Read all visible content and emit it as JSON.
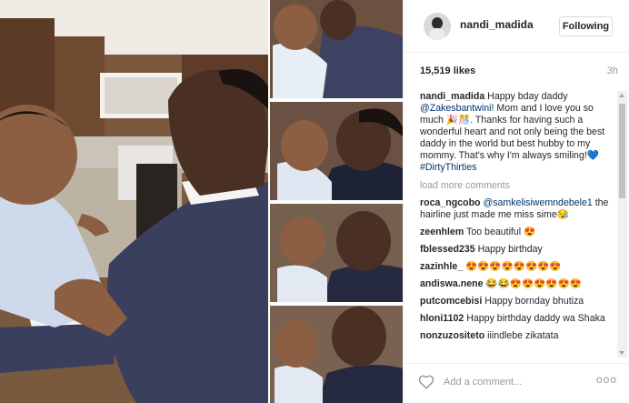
{
  "post": {
    "username": "nandi_madida",
    "follow_label": "Following",
    "likes": "15,519 likes",
    "time": "3h"
  },
  "caption": {
    "username": "nandi_madida",
    "text_1": " Happy bday daddy ",
    "mention": "@Zakesbantwini",
    "text_2": "! Mom and I love you so much 🎉🎊. Thanks for having such a wonderful heart and not only being the best daddy in the world but best hubby to my mommy. That's why I'm always smiling!💙 ",
    "hashtag": "#DirtyThirties"
  },
  "load_more": "load more comments",
  "comments": [
    {
      "user": "roca_ngcobo",
      "mention": "@samkelisiwemndebele1",
      "text": " the hairline just made me miss sime😪"
    },
    {
      "user": "zeenhlem",
      "mention": "",
      "text": " Too beautiful 😍"
    },
    {
      "user": "fblessed235",
      "mention": "",
      "text": " Happy birthday"
    },
    {
      "user": "zazinhle_",
      "mention": "",
      "text": " 😍😍😍😍😍😍😍😍"
    },
    {
      "user": "andiswa.nene",
      "mention": "",
      "text": " 😂😂😍😍😍😍😍😍"
    },
    {
      "user": "putcomcebisi",
      "mention": "",
      "text": " Happy bornday bhutiza"
    },
    {
      "user": "hloni1102",
      "mention": "",
      "text": " Happy birthday daddy wa Shaka"
    },
    {
      "user": "nonzuzositeto",
      "mention": "",
      "text": " iiindlebe zikatata"
    }
  ],
  "footer": {
    "placeholder": "Add a comment...",
    "more_label": "ooo"
  },
  "icons": {
    "like": "heart-icon",
    "options": "more-options-icon",
    "avatar": "avatar"
  },
  "colors": {
    "link": "#003569",
    "muted": "#999999",
    "border": "#efefef"
  }
}
